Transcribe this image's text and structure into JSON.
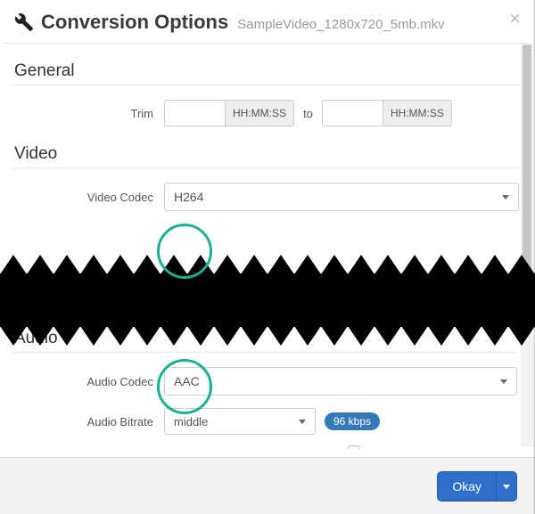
{
  "header": {
    "title": "Conversion Options",
    "subtitle": "SampleVideo_1280x720_5mb.mkv"
  },
  "sections": {
    "general": {
      "title": "General"
    },
    "video": {
      "title": "Video"
    },
    "audio": {
      "title": "Audio"
    }
  },
  "general": {
    "trim_label": "Trim",
    "trim_start_value": "",
    "trim_end_value": "",
    "hhmmss": "HH:MM:SS",
    "to_label": "to"
  },
  "video": {
    "codec_label": "Video Codec",
    "codec_value": "H264"
  },
  "audio": {
    "codec_label": "Audio Codec",
    "codec_value": "AAC",
    "bitrate_label": "Audio Bitrate",
    "bitrate_preset": "middle",
    "bitrate_badge": "96 kbps"
  },
  "footer": {
    "ok_label": "Okay"
  }
}
